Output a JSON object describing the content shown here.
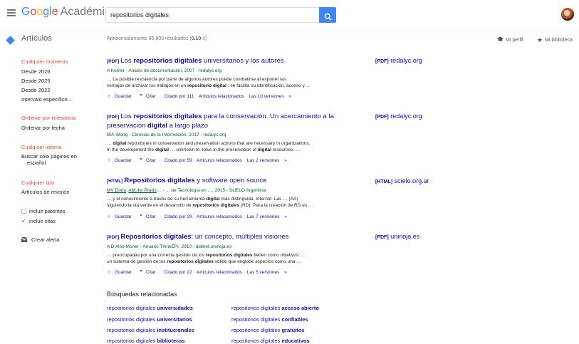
{
  "header": {
    "logo_google": "Google",
    "logo_product": "Académico",
    "search_value": "repositorios digitales"
  },
  "subbar": {
    "section": "Artículos",
    "results_prefix": "Aproximadamente 86,800 resultados (",
    "results_time": "0.10",
    "results_suffix": " s)",
    "profile": "Mi perfil",
    "library": "Mi biblioteca"
  },
  "sidebar": {
    "time": [
      "Cualquier momento",
      "Desde 2026",
      "Desde 2025",
      "Desde 2022",
      "Intervalo específico..."
    ],
    "sort": [
      "Ordenar por relevancia",
      "Ordenar por fecha"
    ],
    "lang": [
      "Cualquier idioma",
      "Buscar solo páginas en",
      "español"
    ],
    "type": [
      "Cualquier tipo",
      "Artículos de revisión"
    ],
    "include_patents": "incluir patentes",
    "include_citations": "incluir citas",
    "create_alert": "Crear alerta"
  },
  "results": [
    {
      "tag": "[PDF]",
      "title_html": "Los <b>repositorios digitales</b> universitarios y los autores",
      "authors": "A Keefer - Anales de documentación, 2007 - redalyc.org",
      "snip1": "… La posible resistencia por parte de algunos autores puede combatirse al exponer las",
      "snip2_html": "ventajas de archivar los trabajos en un <b>repositorio digital</b> : se facilita su identificación, acceso y …",
      "save": "Guardar",
      "cite": "Citar",
      "cited_by": "Citado por 111",
      "related": "Artículos relacionados",
      "versions": "Las 10 versiones",
      "side_tag": "[PDF]",
      "side_domain": "redalyc.org"
    },
    {
      "tag": "[PDF]",
      "title_html": "Los <b>repositorios digitales</b> para la conservación. Un acercamiento a la preservación <b>digital</b> a largo plazo",
      "authors": "BIÀ Wong - Ciencias de la Información, 2017 - redalyc.org",
      "snip1_html": "… <b>digital</b> repositories in conservation and preservation actions that are necessary in organizations.",
      "snip2_html": "In the development the <b>digital</b> … unknown to solve in the preservation of <b>digital</b> resources. …",
      "save": "Guardar",
      "cite": "Citar",
      "cited_by": "Citado por 59",
      "related": "Artículos relacionados",
      "versions": "Las 2 versiones",
      "side_tag": "[PDF]",
      "side_domain": "redalyc.org"
    },
    {
      "tag": "[HTML]",
      "title_html": "<b>Repositorios digitales</b> y software open source",
      "authors_html": "<u>MV Doria</u>, <u>AM del Prado</u>… - … de Tecnología en …, 2015 - SciELO Argentina",
      "snip1_html": "… y el conocimiento a través de su herramienta <b>digital</b> más distinguida, Internet. Las … (AA)",
      "snip2_html": "siguiendo la vía verde en el desarrollo de <b>repositorios digitales</b> (RD). Para la creación de RD es …",
      "save": "Guardar",
      "cite": "Citar",
      "cited_by": "Citado por 29",
      "related": "Artículos relacionados",
      "versions": "Las 7 versiones",
      "side_tag": "[HTML]",
      "side_domain": "scielo.org.ar"
    },
    {
      "tag": "[PDF]",
      "title_html": "<b>Repositorios digitales</b>: un concepto, múltiples visiones",
      "authors": "A D'Alòs-Moner - Anuario ThinkEPI, 2010 - dialnet.unirioja.es",
      "snip1_html": "… preocupadas por una correcta gestión de los <b>repositorios digitales</b> tienen como objetivos: …",
      "snip2_html": "un sistema de gestión de los <b>repositorios digitales</b> sólido que englobe aspectos como una …",
      "save": "Guardar",
      "cite": "Citar",
      "cited_by": "Citado por 22",
      "related": "Artículos relacionados",
      "versions": "Las 5 versiones",
      "side_tag": "[PDF]",
      "side_domain": "unirioja.es"
    }
  ],
  "related": {
    "heading": "Búsquedas relacionadas",
    "prefix": "repositorios digitales",
    "left": [
      "universidades",
      "universitarios",
      "institucionales",
      "bibliotecas"
    ],
    "right": [
      "acceso abierto",
      "confiables",
      "gratuitos",
      "educativos"
    ]
  }
}
